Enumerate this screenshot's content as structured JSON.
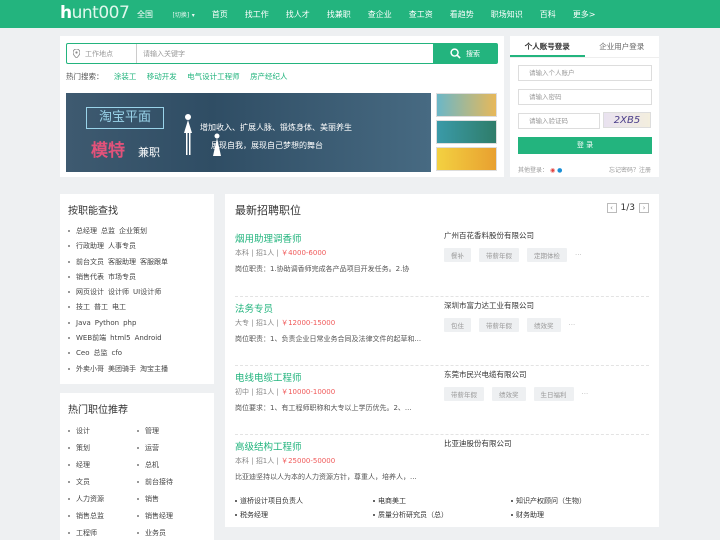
{
  "logo": {
    "h": "h",
    "rest": "unt007"
  },
  "nav": {
    "city": "全国",
    "city_sub": "[切换]",
    "items": [
      "首页",
      "找工作",
      "找人才",
      "找兼职",
      "查企业",
      "查工资",
      "看趋势",
      "职场知识",
      "百科",
      "更多>"
    ]
  },
  "search": {
    "location_placeholder": "工作地点",
    "keyword_placeholder": "请输入关键字",
    "button": "搜索"
  },
  "hot_search": {
    "label": "热门搜索：",
    "items": [
      "涂装工",
      "移动开发",
      "电气设计工程师",
      "房产经纪人"
    ]
  },
  "banner": {
    "box": "淘宝平面",
    "model": "模特",
    "part_time": "兼职",
    "line1": "增加收入、扩展人脉、锻炼身体、美丽养生",
    "line2": "展现自我，展现自己梦想的舞台"
  },
  "login": {
    "tab_personal": "个人账号登录",
    "tab_company": "企业用户登录",
    "user_placeholder": "请输入个人账户",
    "pwd_placeholder": "请输入密码",
    "code_placeholder": "请输入验证码",
    "captcha": "2XB5",
    "button": "登 录",
    "other": "其他登录：",
    "forgot": "忘记密码？注册"
  },
  "by_function": {
    "title": "按职能查找",
    "rows": [
      [
        "总经理",
        "总监",
        "企业策划"
      ],
      [
        "行政助理",
        "人事专员"
      ],
      [
        "前台文员",
        "客服助理",
        "客服跟单"
      ],
      [
        "销售代表",
        "市场专员"
      ],
      [
        "网页设计",
        "设计师",
        "UI设计师"
      ],
      [
        "技工",
        "普工",
        "电工"
      ],
      [
        "Java",
        "Python",
        "php"
      ],
      [
        "WEB前端",
        "html5",
        "Android"
      ],
      [
        "Ceo",
        "总监",
        "cfo"
      ],
      [
        "外卖小哥",
        "美团骑手",
        "淘宝主播"
      ]
    ]
  },
  "hot_jobs": {
    "title": "热门职位推荐",
    "items": [
      "设计",
      "管理",
      "策划",
      "运营",
      "经理",
      "总机",
      "文员",
      "前台接待",
      "人力资源",
      "销售",
      "销售总监",
      "销售经理",
      "工程师",
      "业务员"
    ]
  },
  "latest": {
    "title": "最新招聘职位",
    "page": "1/3",
    "jobs": [
      {
        "title": "烟用助理调香师",
        "edu": "本科",
        "count": "招1人",
        "salary": "￥4000-6000",
        "desc": "岗位职责：1.协助调香师完成各产品项目开发任务。2.协",
        "company": "广州百花香料股份有限公司",
        "tags": [
          "餐补",
          "带薪年假",
          "定期体检"
        ]
      },
      {
        "title": "法务专员",
        "edu": "大专",
        "count": "招1人",
        "salary": "￥12000-15000",
        "desc": "岗位职责：1、负责企业日常业务合同及法律文件的起草和...",
        "company": "深圳市富力达工业有限公司",
        "tags": [
          "包住",
          "带薪年假",
          "绩效奖"
        ]
      },
      {
        "title": "电线电缆工程师",
        "edu": "初中",
        "count": "招1人",
        "salary": "￥10000-10000",
        "desc": "岗位要求：1、有工程师职称和大专以上学历优先。2、...",
        "company": "东莞市民兴电缆有限公司",
        "tags": [
          "带薪年假",
          "绩效奖",
          "生日福利"
        ]
      },
      {
        "title": "高级结构工程师",
        "edu": "本科",
        "count": "招1人",
        "salary": "￥25000-50000",
        "desc": "比亚迪坚持以人为本的人力资源方针，尊重人，培养人，...",
        "company": "比亚迪股份有限公司",
        "tags": []
      }
    ],
    "links": [
      "道桥设计项目负责人",
      "电商美工",
      "知识产权顾问（生物）",
      "税务经理",
      "质量分析研究员（总）",
      "财务助理"
    ]
  }
}
